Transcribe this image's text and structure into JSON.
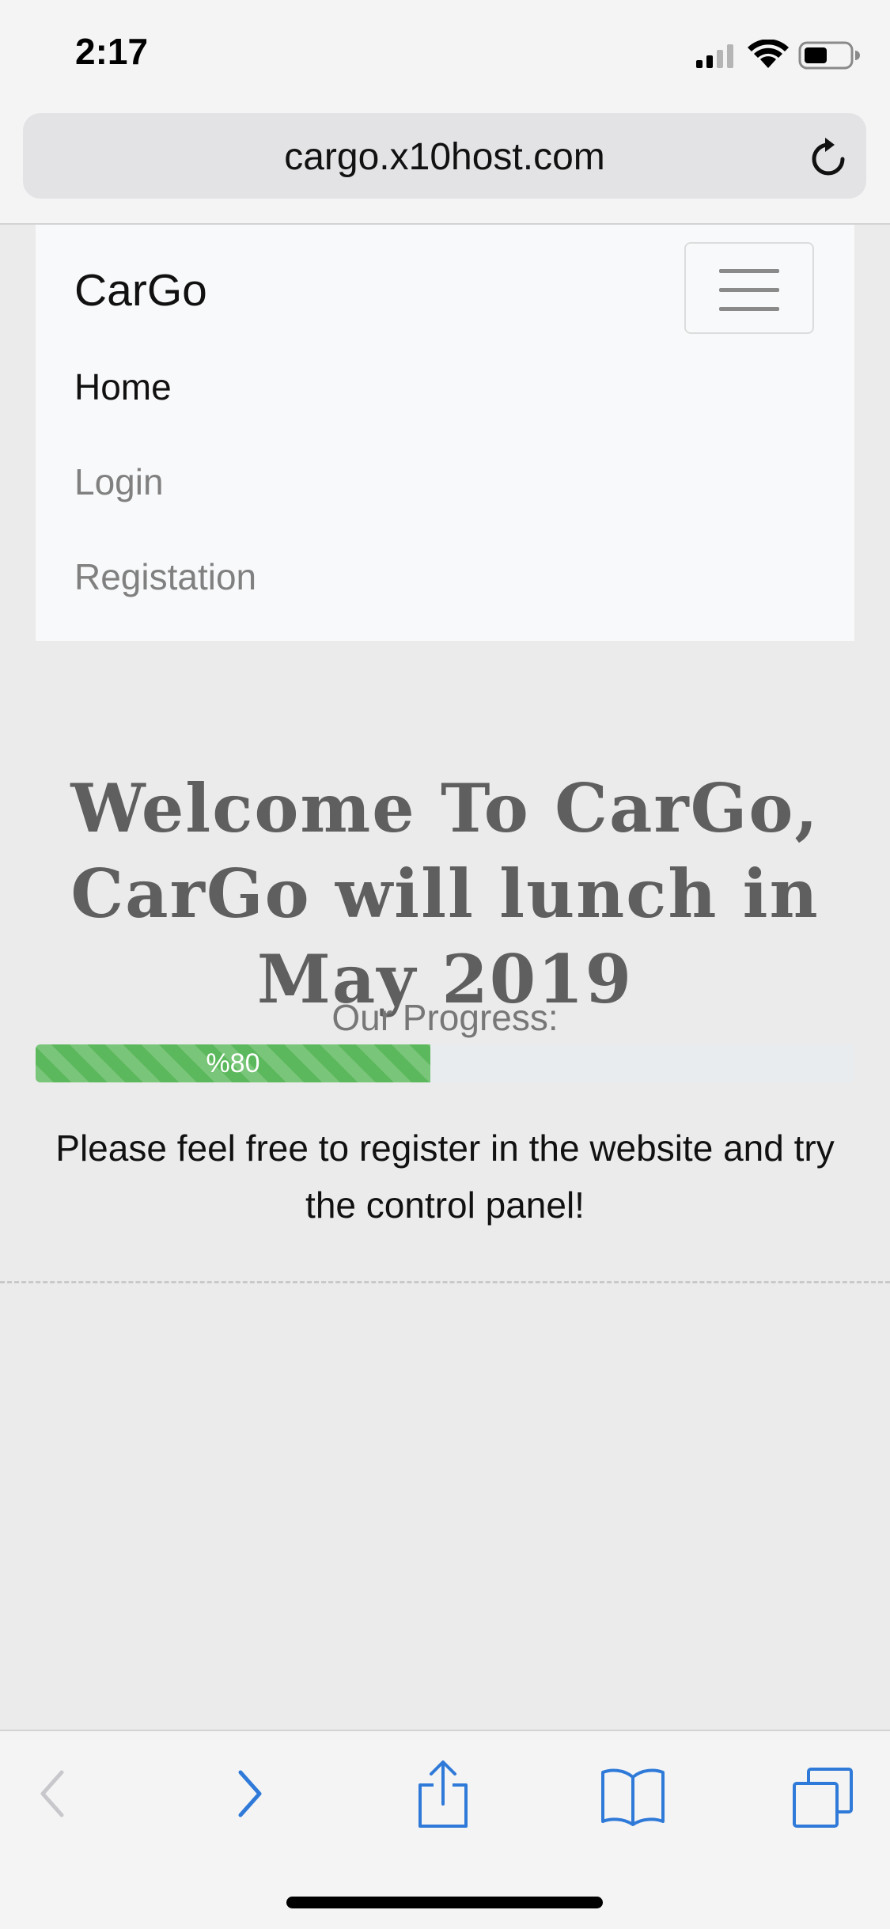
{
  "status_bar": {
    "time": "2:17",
    "icons": [
      "cellular-signal-icon",
      "wifi-icon",
      "battery-icon"
    ]
  },
  "browser": {
    "url": "cargo.x10host.com",
    "reload_icon": "reload-icon",
    "toolbar": {
      "buttons": [
        "back-icon",
        "forward-icon",
        "share-icon",
        "bookmarks-icon",
        "tabs-icon"
      ],
      "back_enabled": false
    }
  },
  "navbar": {
    "brand": "CarGo",
    "toggle_icon": "hamburger-icon",
    "links": [
      {
        "label": "Home",
        "active": true
      },
      {
        "label": "Login",
        "active": false
      },
      {
        "label": "Registation",
        "active": false
      }
    ]
  },
  "hero": {
    "title_lines": [
      "Welcome To CarGo,",
      "CarGo will lunch in",
      "May 2019"
    ],
    "progress_label": "Our Progress:",
    "progress_text": "%80",
    "progress_value": 80,
    "invite_text": "Please feel free to register in the website and try the control panel!"
  },
  "colors": {
    "progress_fill": "#5cb85c",
    "toolbar_accent": "#2f7ad8",
    "hero_text": "#5f5f5f"
  }
}
